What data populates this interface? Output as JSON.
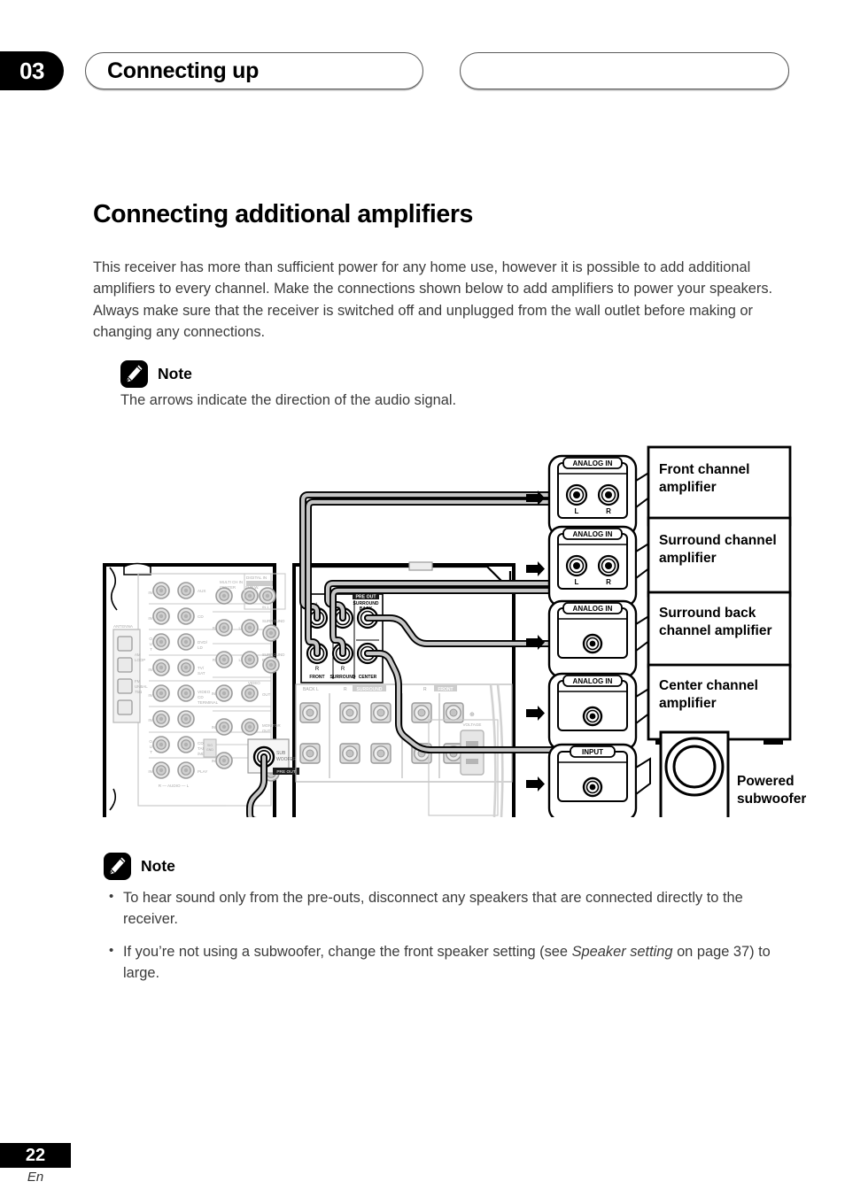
{
  "header": {
    "chapter_number": "03",
    "chapter_title": "Connecting up",
    "right_pill_title": ""
  },
  "page": {
    "title": "Connecting additional amplifiers",
    "intro": "This receiver has more than sufficient power for any home use, however it is possible to add additional amplifiers to every channel. Make the connections shown below to add amplifiers to power your speakers. Always make sure that the receiver is switched off and unplugged from the wall outlet before making or changing any connections."
  },
  "note_top": {
    "label": "Note",
    "icon": "pencil-icon",
    "body": "The arrows indicate the direction of the audio signal."
  },
  "note_bottom": {
    "label": "Note",
    "icon": "pencil-icon",
    "bullets": [
      {
        "pre": "To hear sound only from the pre-outs, disconnect any speakers that are connected directly to the receiver.",
        "italic": "",
        "post": ""
      },
      {
        "pre": "If you’re not using a subwoofer, change the front speaker setting (see ",
        "italic": "Speaker setting",
        "post": " on page 37) to large."
      }
    ]
  },
  "diagram": {
    "arrow_icon": "right-arrow-icon",
    "devices": [
      {
        "jack_label": "ANALOG  IN",
        "jack_type": "stereo",
        "left_label": "L",
        "right_label": "R",
        "name": "Front channel\namplifier",
        "name_line1": "Front channel",
        "name_line2": "amplifier"
      },
      {
        "jack_label": "ANALOG  IN",
        "jack_type": "stereo",
        "left_label": "L",
        "right_label": "R",
        "name": "Surround channel amplifier",
        "name_line1": "Surround channel",
        "name_line2": "amplifier"
      },
      {
        "jack_label": "ANALOG  IN",
        "jack_type": "mono",
        "left_label": "",
        "right_label": "",
        "name": "Surround back channel amplifier",
        "name_line1": "Surround back",
        "name_line2": "channel amplifier"
      },
      {
        "jack_label": "ANALOG  IN",
        "jack_type": "mono",
        "left_label": "",
        "right_label": "",
        "name": "Center channel amplifier",
        "name_line1": "Center channel",
        "name_line2": "amplifier"
      },
      {
        "jack_label": "INPUT",
        "jack_type": "mono",
        "left_label": "",
        "right_label": "",
        "name": "Powered subwoofer",
        "name_line1": "Powered",
        "name_line2": "subwoofer"
      }
    ],
    "receiver": {
      "preout_group_label": "PRE OUT",
      "preout_labels": [
        "L",
        "L",
        "SURROUND BACK",
        "R",
        "R",
        "CENTER"
      ],
      "preout_channels": [
        "FRONT",
        "SURROUND",
        "CENTER",
        "SURROUND BACK"
      ],
      "subwoofer_jack_label_line1": "SUB",
      "subwoofer_jack_label_line2": "WOOFER",
      "subwoofer_preout_tag": "PRE OUT",
      "panel_labels": [
        "ANTENNA",
        "AM LOOP",
        "FM UNBAL 75Ω",
        "AUX",
        "CD",
        "CD-R/TAPE/MD",
        "DVD/LD",
        "TV/SAT",
        "VIDEO",
        "PLAY",
        "REC",
        "R — AUDIO — L",
        "IN",
        "OUT",
        "DIGITAL IN",
        "COAXIAL",
        "OPTICAL",
        "MULTI CH IN",
        "CENTER",
        "SUB W.",
        "SURROUND",
        "SURROUND BACK",
        "MONITOR OUT",
        "SUBWOOFER",
        "PRE OUT",
        "FRONT"
      ],
      "speaker_terminal_labels": [
        "SURROUND BACK",
        "L",
        "R",
        "SURROUND",
        "L",
        "R",
        "FRONT",
        "L",
        "R"
      ]
    }
  },
  "footer": {
    "page_number": "22",
    "language": "En"
  },
  "colors": {
    "ink": "#000000",
    "body_text": "#3b3b3b",
    "panel_gray": "#c9c9c9",
    "panel_line": "#9a9a9a",
    "cable_gray": "#b5b5b5"
  }
}
